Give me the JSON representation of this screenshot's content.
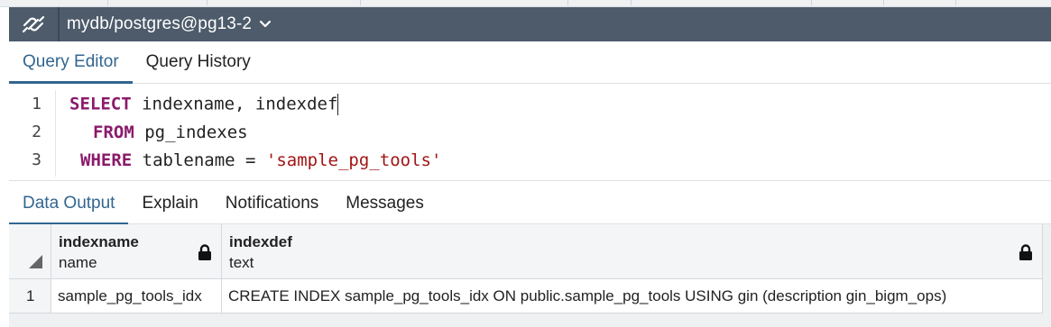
{
  "connection": {
    "label": "mydb/postgres@pg13-2",
    "logo_icon": "elephant-link-icon",
    "dropdown_icon": "chevron-down-icon"
  },
  "query_tabs": [
    {
      "label": "Query Editor",
      "active": true
    },
    {
      "label": "Query History",
      "active": false
    }
  ],
  "editor": {
    "line_numbers": [
      "1",
      "2",
      "3"
    ],
    "lines": [
      {
        "kw": "SELECT",
        "rest": " indexname, indexdef"
      },
      {
        "kw": "FROM",
        "rest": " pg_indexes"
      },
      {
        "kw": "WHERE",
        "rest_plain": " tablename = ",
        "rest_str": "'sample_pg_tools'"
      }
    ]
  },
  "result_tabs": [
    {
      "label": "Data Output",
      "active": true
    },
    {
      "label": "Explain",
      "active": false
    },
    {
      "label": "Notifications",
      "active": false
    },
    {
      "label": "Messages",
      "active": false
    }
  ],
  "grid": {
    "columns": [
      {
        "name": "indexname",
        "type": "name",
        "icon": "lock-icon"
      },
      {
        "name": "indexdef",
        "type": "text",
        "icon": "lock-icon"
      }
    ],
    "rows": [
      {
        "num": "1",
        "cells": [
          "sample_pg_tools_idx",
          "CREATE INDEX sample_pg_tools_idx ON public.sample_pg_tools USING gin (description gin_bigm_ops)"
        ]
      }
    ]
  },
  "colors": {
    "header_bg": "#4d5b6b",
    "accent": "#326690",
    "keyword": "#8b1a6b",
    "string": "#a21515"
  }
}
